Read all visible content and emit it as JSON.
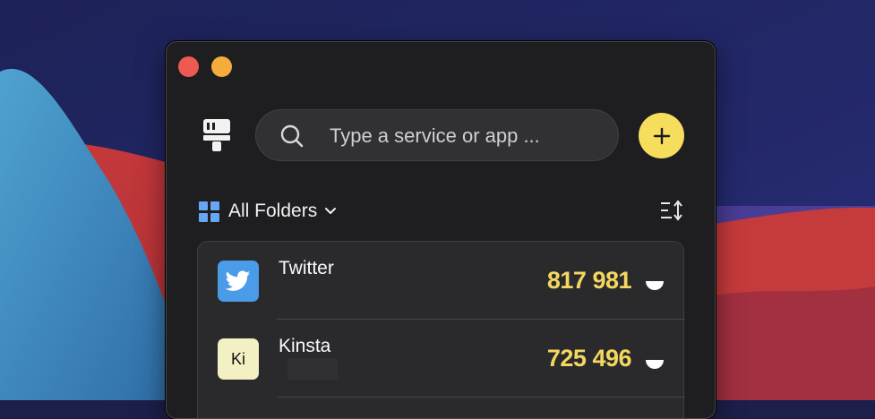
{
  "header": {
    "search_placeholder": "Type a service or app ..."
  },
  "toolbar": {
    "folders_label": "All Folders"
  },
  "accounts": [
    {
      "name": "Twitter",
      "code": "817 981",
      "icon": "twitter-bird-icon",
      "color": "#4a9be8"
    },
    {
      "name": "Kinsta",
      "code": "725 496",
      "icon_text": "Ki",
      "color": "#f3f0c4"
    }
  ],
  "colors": {
    "accent": "#f7dd5c",
    "code": "#f4d760",
    "window_bg": "#1e1e20",
    "folder_icon": "#67a6f2"
  }
}
